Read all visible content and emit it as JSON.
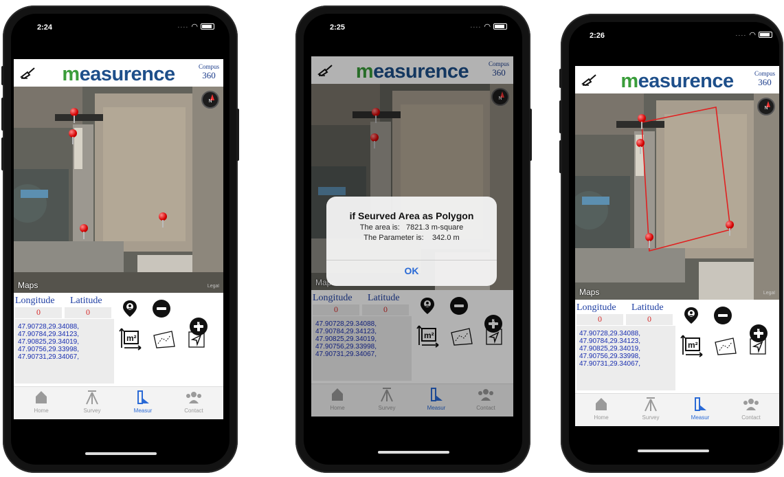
{
  "app": {
    "brand": "measurence",
    "compus_label": "Compus",
    "compus_value": "360",
    "maps_label": "Maps",
    "legal_label": "Legal",
    "compass_label": "N"
  },
  "coords": {
    "longitude_label": "Longitude",
    "latitude_label": "Latitude",
    "longitude_value": "0",
    "latitude_value": "0",
    "list": "47.90728,29.34088,\n47.90784,29.34123,\n47.90825,29.34019,\n47.90756,29.33998,\n47.90731,29.34067,",
    "point_count": "5"
  },
  "tabs": [
    {
      "label": "Home",
      "icon": "home-icon"
    },
    {
      "label": "Survey",
      "icon": "survey-tripod-icon"
    },
    {
      "label": "Measur",
      "icon": "measure-icon"
    },
    {
      "label": "Contact",
      "icon": "contact-people-icon"
    }
  ],
  "phones": [
    {
      "time": "2:24"
    },
    {
      "time": "2:25"
    },
    {
      "time": "2:26"
    }
  ],
  "dialog": {
    "title": "if Seurved Area as Polygon",
    "area_line": "The area is:   7821.3 m-square",
    "param_line": "The Parameter is:    342.0 m",
    "ok_label": "OK"
  },
  "colors": {
    "accent": "#2a6ad6",
    "pin": "#d40000",
    "polygon": "#e02020",
    "coord_text": "#1a2fb0",
    "coord_value": "#d62a2a"
  }
}
